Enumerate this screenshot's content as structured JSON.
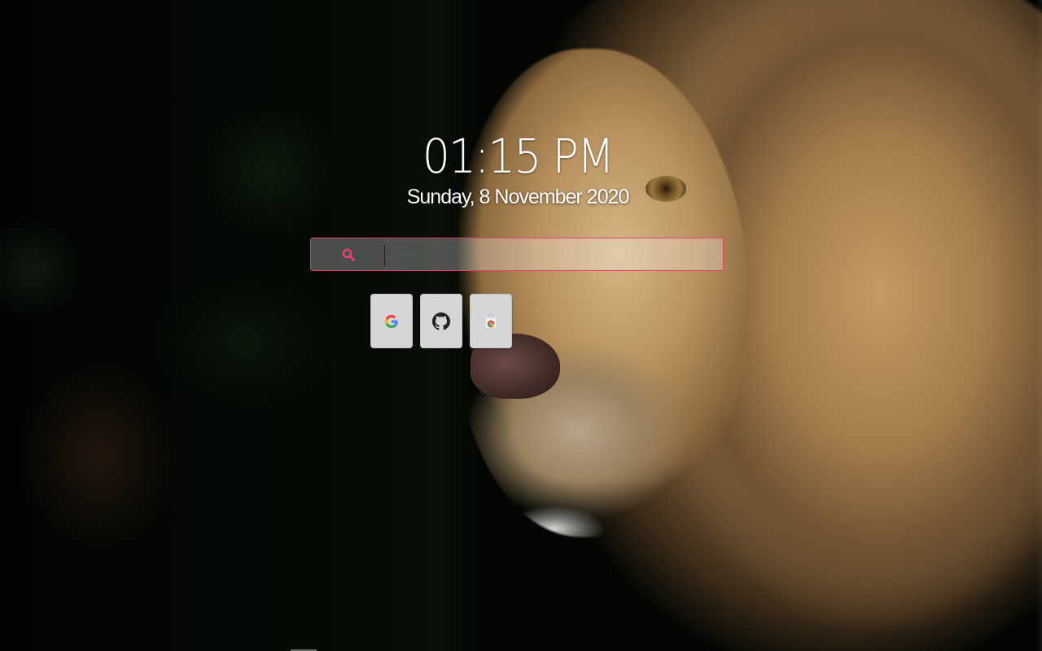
{
  "clock": {
    "time": "01:15 PM",
    "date": "Sunday, 8 November 2020"
  },
  "search": {
    "placeholder": "Search...",
    "value": "",
    "icon": "search-icon",
    "accent_color": "#e8406c"
  },
  "shortcuts": [
    {
      "icon": "google-icon"
    },
    {
      "icon": "github-icon"
    },
    {
      "icon": "chrome-web-store-icon"
    }
  ],
  "background": {
    "subject": "lion",
    "base_color": "#030603"
  }
}
